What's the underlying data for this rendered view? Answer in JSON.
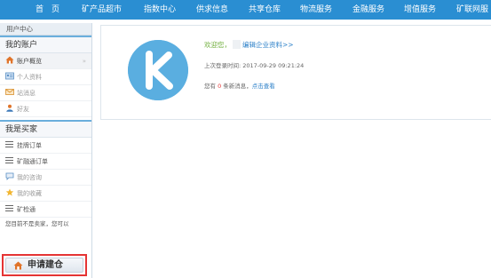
{
  "nav": {
    "items": [
      "首　页",
      "矿产品超市",
      "指数中心",
      "供求信息",
      "共享仓库",
      "物流服务",
      "金融服务",
      "增值服务",
      "矿联网服"
    ]
  },
  "sidebar": {
    "top_title": "用户中心",
    "account_section": {
      "title": "我的账户",
      "items": [
        {
          "label": "账户概览",
          "icon": "home-icon",
          "active": true
        },
        {
          "label": "个人资料",
          "icon": "id-card-icon"
        },
        {
          "label": "站消息",
          "icon": "envelope-icon"
        },
        {
          "label": "好友",
          "icon": "user-icon"
        }
      ]
    },
    "buyer_section": {
      "title": "我是买家",
      "items": [
        {
          "label": "挂牌订单",
          "icon": "list-icon"
        },
        {
          "label": "矿融通订单",
          "icon": "list-icon"
        },
        {
          "label": "我的咨询",
          "icon": "chat-icon"
        },
        {
          "label": "我的收藏",
          "icon": "star-icon"
        },
        {
          "label": "矿检通",
          "icon": "list-icon"
        }
      ]
    },
    "note": "您目前不是卖家，您可以",
    "apply_button": "申请建仓"
  },
  "main": {
    "welcome_prefix": "欢迎您，",
    "edit_link": "编辑企业资料>>",
    "last_login": "上次登录时间: 2017-09-29 09:21:24",
    "msg_prefix": "您有",
    "msg_count": "0",
    "msg_middle": "条新消息，",
    "msg_link": "点击查看"
  },
  "colors": {
    "nav_bg": "#2a8ed2",
    "avatar_bg": "#5aaee0",
    "highlight_border": "#e53434"
  }
}
